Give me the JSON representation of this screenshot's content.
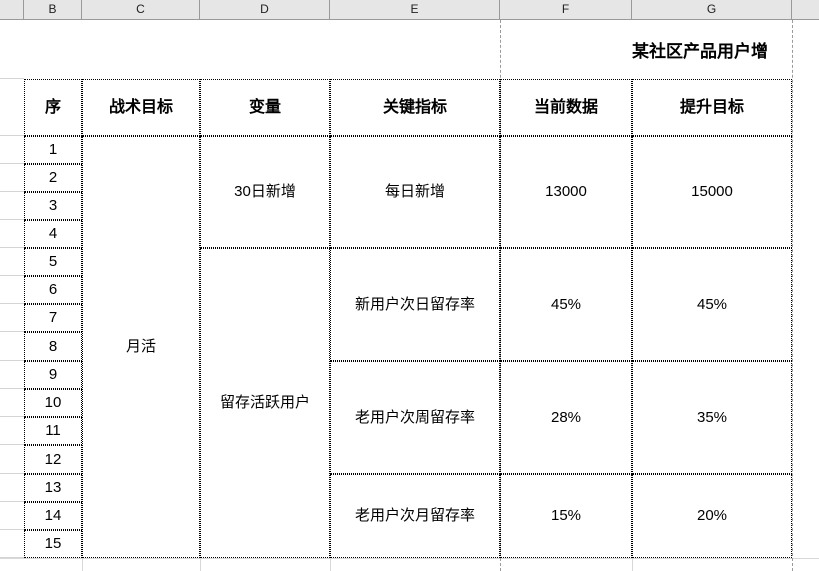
{
  "spreadsheet": {
    "column_headers": [
      "B",
      "C",
      "D",
      "E",
      "F",
      "G"
    ],
    "title": "某社区产品用户增",
    "table": {
      "headers": [
        "序",
        "战术目标",
        "变量",
        "关键指标",
        "当前数据",
        "提升目标"
      ],
      "row_numbers": [
        "1",
        "2",
        "3",
        "4",
        "5",
        "6",
        "7",
        "8",
        "9",
        "10",
        "11",
        "12",
        "13",
        "14",
        "15"
      ],
      "tactical_goal": "月活",
      "variables": [
        {
          "label": "30日新增",
          "rows": "1-4"
        },
        {
          "label": "留存活跃用户",
          "rows": "5-15"
        }
      ],
      "metrics": [
        {
          "key_indicator": "每日新增",
          "current": "13000",
          "target": "15000"
        },
        {
          "key_indicator": "新用户次日留存率",
          "current": "45%",
          "target": "45%"
        },
        {
          "key_indicator": "老用户次周留存率",
          "current": "28%",
          "target": "35%"
        },
        {
          "key_indicator": "老用户次月留存率",
          "current": "15%",
          "target": "20%"
        }
      ]
    }
  }
}
